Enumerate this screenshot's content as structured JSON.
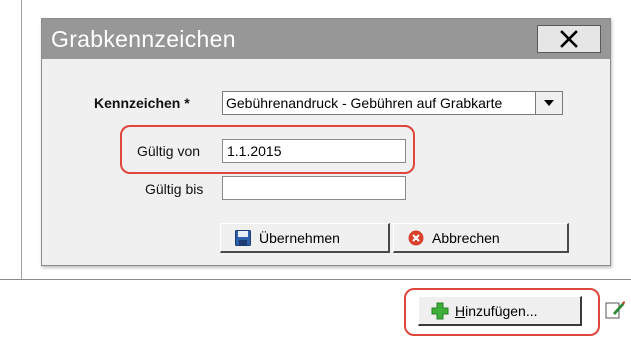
{
  "dialog": {
    "title": "Grabkennzeichen",
    "close_label": "X",
    "kennzeichen_label": "Kennzeichen *",
    "kennzeichen_value": "Gebührenandruck - Gebühren auf Grabkarte",
    "gueltig_von_label": "Gültig von",
    "gueltig_von_value": "1.1.2015",
    "gueltig_bis_label": "Gültig bis",
    "gueltig_bis_value": "",
    "ok_label": "Übernehmen",
    "cancel_label": "Abbrechen"
  },
  "toolbar": {
    "add_label_accel": "H",
    "add_label_rest": "inzufügen..."
  },
  "colors": {
    "highlight": "#e0463c",
    "titlebar": "#979797"
  },
  "icons": [
    "close-icon",
    "dropdown-arrow-icon",
    "save-icon",
    "cancel-icon",
    "add-icon",
    "edit-icon"
  ]
}
